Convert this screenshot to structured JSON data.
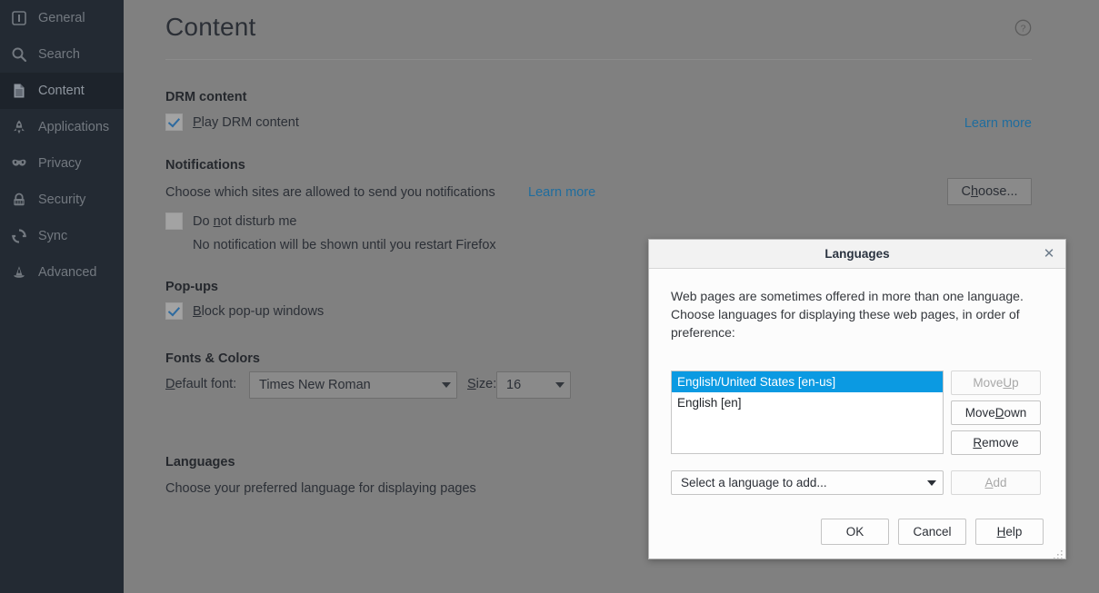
{
  "sidebar": {
    "items": [
      {
        "label": "General",
        "icon": "sliders-panel-icon",
        "selected": false
      },
      {
        "label": "Search",
        "icon": "magnifier-icon",
        "selected": false
      },
      {
        "label": "Content",
        "icon": "document-icon",
        "selected": true
      },
      {
        "label": "Applications",
        "icon": "rocket-icon",
        "selected": false
      },
      {
        "label": "Privacy",
        "icon": "mask-icon",
        "selected": false
      },
      {
        "label": "Security",
        "icon": "padlock-icon",
        "selected": false
      },
      {
        "label": "Sync",
        "icon": "refresh-icon",
        "selected": false
      },
      {
        "label": "Advanced",
        "icon": "wizard-hat-icon",
        "selected": false
      }
    ]
  },
  "main": {
    "title": "Content",
    "help_icon": "question-circle-icon",
    "drm": {
      "heading": "DRM content",
      "checkbox_label": "Play DRM content",
      "checkbox_checked": true,
      "learn_more": "Learn more"
    },
    "notifications": {
      "heading": "Notifications",
      "description": "Choose which sites are allowed to send you notifications",
      "learn_more": "Learn more",
      "choose_button": "Choose...",
      "dnd_label": "Do not disturb me",
      "dnd_checked": false,
      "dnd_note": "No notification will be shown until you restart Firefox"
    },
    "popups": {
      "heading": "Pop-ups",
      "checkbox_label": "Block pop-up windows",
      "checkbox_checked": true
    },
    "fonts": {
      "heading": "Fonts & Colors",
      "font_label": "Default font:",
      "font_value": "Times New Roman",
      "size_label": "Size:",
      "size_value": "16"
    },
    "languages": {
      "heading": "Languages",
      "description": "Choose your preferred language for displaying pages"
    }
  },
  "dialog": {
    "title": "Languages",
    "close_icon": "close-x-icon",
    "description": "Web pages are sometimes offered in more than one language. Choose languages for displaying these web pages, in order of preference:",
    "list": [
      {
        "label": "English/United States  [en-us]",
        "selected": true
      },
      {
        "label": "English  [en]",
        "selected": false
      }
    ],
    "buttons": {
      "move_up": "Move Up",
      "move_up_enabled": false,
      "move_down": "Move Down",
      "move_down_enabled": true,
      "remove": "Remove",
      "remove_enabled": true,
      "add": "Add",
      "add_enabled": false
    },
    "select_placeholder": "Select a language to add...",
    "footer": {
      "ok": "OK",
      "cancel": "Cancel",
      "help": "Help"
    }
  },
  "colors": {
    "sidebar_bg": "#232a33",
    "overlay_gray": "#808080",
    "link_blue": "#1f6d9e",
    "selection_blue": "#0b9ae2",
    "check_blue": "#2d6a9f"
  }
}
